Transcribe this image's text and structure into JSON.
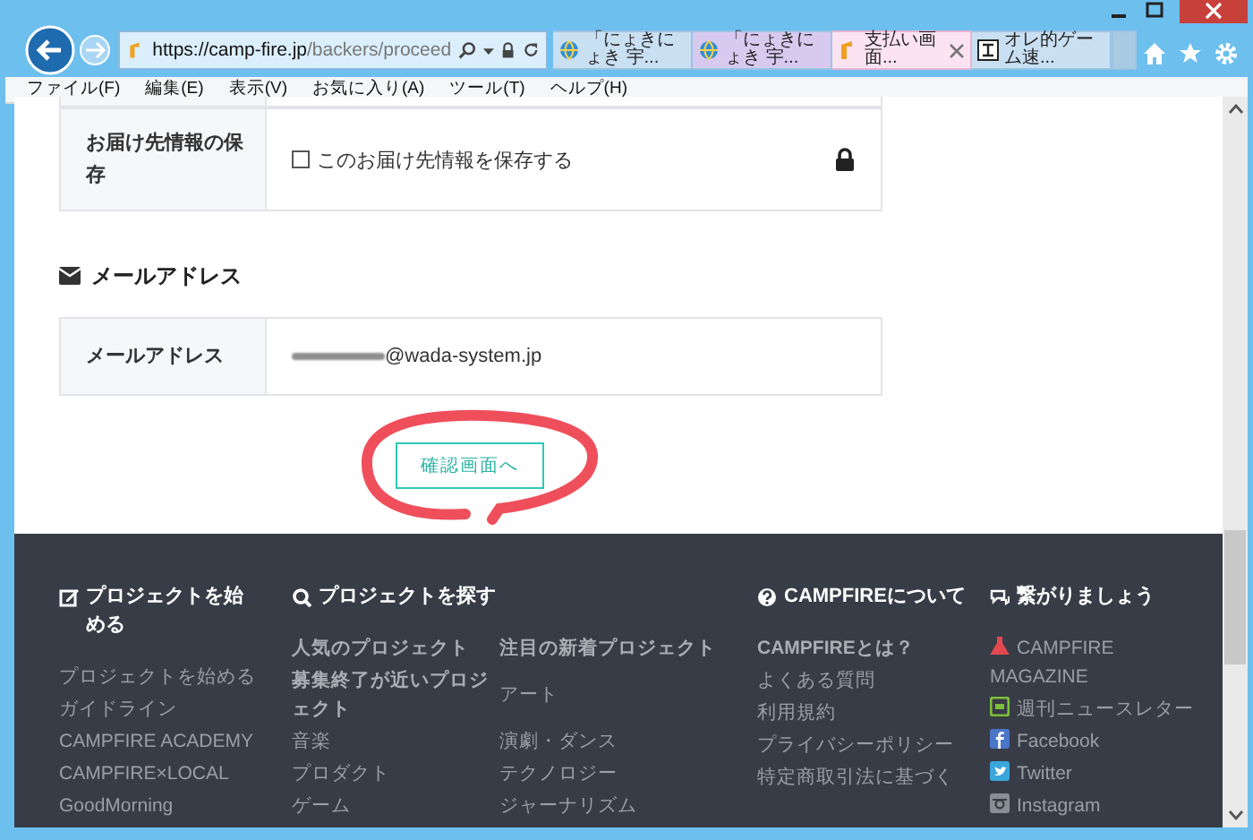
{
  "browser": {
    "address": {
      "host": "https://camp-fire.jp",
      "path": "/backers/proceed"
    },
    "tabs": [
      {
        "label": "「にょきにょき 宇...",
        "color": "#c9dff2",
        "selected": false
      },
      {
        "label": "「にょきにょき 宇...",
        "color": "#d8c9ef",
        "selected": false
      },
      {
        "label": "支払い画面...",
        "color": "#fbe3f1",
        "selected": true
      },
      {
        "label": "オレ的ゲーム速...",
        "color": "#c9dff2",
        "selected": false
      }
    ],
    "menu": [
      "ファイル(F)",
      "編集(E)",
      "表示(V)",
      "お気に入り(A)",
      "ツール(T)",
      "ヘルプ(H)"
    ]
  },
  "page": {
    "save_row": {
      "label": "お届け先情報の保存",
      "checkbox": {
        "label": "このお届け先情報を保存する",
        "checked": false
      }
    },
    "email_section": {
      "heading": "メールアドレス",
      "label": "メールアドレス",
      "value": "@wada-system.jp"
    },
    "confirm_button": "確認画面へ"
  },
  "footer": {
    "columns": [
      {
        "heading": "プロジェクトを始める",
        "rows": [
          [
            {
              "text": "プロジェクトを始める",
              "bold": false
            }
          ],
          [
            {
              "text": "ガイドライン",
              "bold": false
            }
          ],
          [
            {
              "text": "CAMPFIRE ACADEMY",
              "bold": false
            }
          ],
          [
            {
              "text": "CAMPFIRE×LOCAL",
              "bold": false
            }
          ],
          [
            {
              "text": "GoodMorning",
              "bold": false
            }
          ]
        ]
      },
      {
        "heading": "プロジェクトを探す",
        "rows": [
          [
            {
              "text": "人気のプロジェクト",
              "bold": true
            },
            {
              "text": "注目の新着プロジェクト",
              "bold": true
            }
          ],
          [
            {
              "text": "募集終了が近いプロジェクト",
              "bold": true
            },
            {
              "text": "アート",
              "bold": false
            }
          ],
          [
            {
              "text": "音楽",
              "bold": false
            },
            {
              "text": "演劇・ダンス",
              "bold": false
            }
          ],
          [
            {
              "text": "プロダクト",
              "bold": false
            },
            {
              "text": "テクノロジー",
              "bold": false
            }
          ],
          [
            {
              "text": "ゲーム",
              "bold": false
            },
            {
              "text": "ジャーナリズム",
              "bold": false
            }
          ]
        ]
      },
      {
        "heading": "CAMPFIREについて",
        "rows": [
          [
            {
              "text": "CAMPFIREとは？",
              "bold": true
            }
          ],
          [
            {
              "text": "よくある質問",
              "bold": false
            }
          ],
          [
            {
              "text": "利用規約",
              "bold": false
            }
          ],
          [
            {
              "text": "プライバシーポリシー",
              "bold": false
            }
          ],
          [
            {
              "text": "特定商取引法に基づく",
              "bold": false
            }
          ]
        ]
      },
      {
        "heading": "繋がりましょう",
        "rows": [
          [
            {
              "text": "CAMPFIRE MAGAZINE",
              "bold": false
            }
          ],
          [
            {
              "text": "週刊ニュースレター",
              "bold": false
            }
          ],
          [
            {
              "text": "Facebook",
              "bold": false
            }
          ],
          [
            {
              "text": "Twitter",
              "bold": false
            }
          ],
          [
            {
              "text": "Instagram",
              "bold": false
            }
          ]
        ]
      }
    ]
  }
}
